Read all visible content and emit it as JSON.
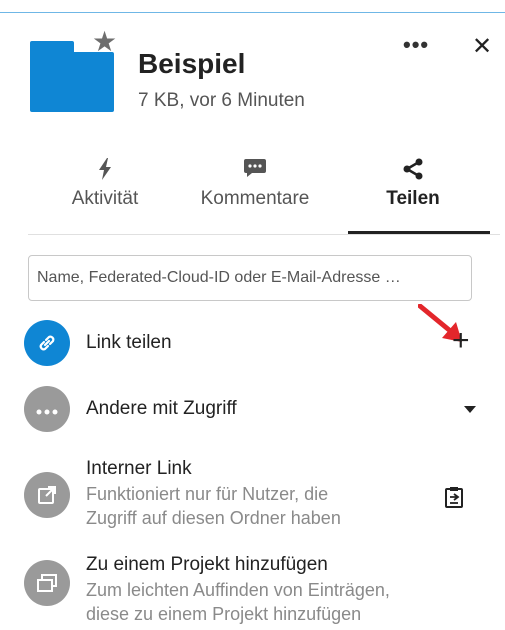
{
  "header": {
    "title": "Beispiel",
    "subtitle": "7 KB, vor 6 Minuten",
    "menu_glyph": "•••",
    "close_glyph": "✕"
  },
  "tabs": [
    {
      "label": "Aktivität",
      "icon": "bolt-icon",
      "active": false
    },
    {
      "label": "Kommentare",
      "icon": "comment-icon",
      "active": false
    },
    {
      "label": "Teilen",
      "icon": "share-icon",
      "active": true
    }
  ],
  "share_input": {
    "placeholder": "Name, Federated-Cloud-ID oder E-Mail-Adresse …"
  },
  "rows": {
    "link": {
      "label": "Link teilen",
      "action_glyph": "+"
    },
    "others": {
      "label": "Andere mit Zugriff"
    },
    "internal": {
      "label": "Interner Link",
      "sub1": "Funktioniert nur für Nutzer, die",
      "sub2": "Zugriff auf diesen Ordner haben"
    },
    "project": {
      "label": "Zu einem Projekt hinzufügen",
      "sub1": "Zum leichten Auffinden von Einträgen,",
      "sub2": "diese zu einem Projekt hinzufügen"
    }
  },
  "colors": {
    "accent": "#0f86d4",
    "gray_icon": "#9a9a9a",
    "arrow": "#e3262b"
  }
}
